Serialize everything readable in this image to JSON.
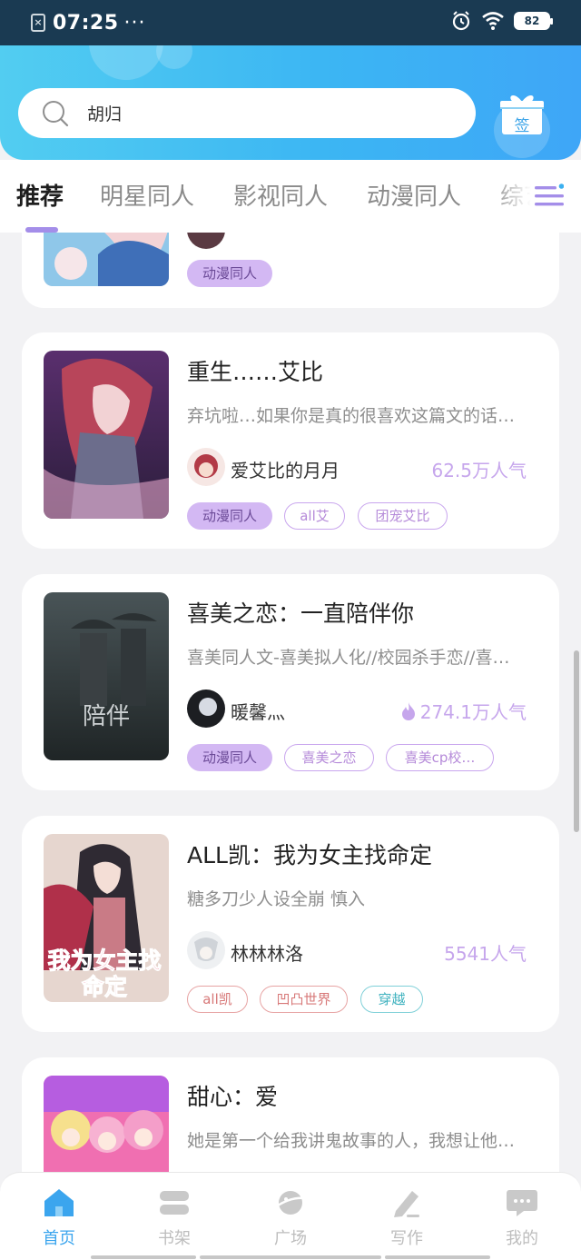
{
  "status_bar": {
    "time": "07:25",
    "dots": "···",
    "battery": "82"
  },
  "search": {
    "query": "胡归"
  },
  "checkin": {
    "label": "签"
  },
  "tabs": [
    {
      "label": "推荐"
    },
    {
      "label": "明星同人"
    },
    {
      "label": "影视同人"
    },
    {
      "label": "动漫同人"
    },
    {
      "label": "综艺"
    }
  ],
  "cards": [
    {
      "title": "",
      "author": "",
      "popularity": "",
      "tags": [
        "动漫同人"
      ]
    },
    {
      "title": "重生……艾比",
      "desc": "弃坑啦…如果你是真的很喜欢这篇文的话…",
      "author": "爱艾比的月月",
      "popularity": "62.5万人气",
      "tags": [
        "动漫同人",
        "all艾",
        "团宠艾比"
      ]
    },
    {
      "title": "喜美之恋：一直陪伴你",
      "desc": "喜美同人文-喜美拟人化//校园杀手恋//喜…",
      "author": "暖馨灬",
      "popularity": "274.1万人气",
      "tags": [
        "动漫同人",
        "喜美之恋",
        "喜美cp校…"
      ]
    },
    {
      "title": "ALL凯：我为女主找命定",
      "desc": "糖多刀少人设全崩 慎入",
      "author": "林林林洛",
      "popularity": "5541人气",
      "tags": [
        "all凯",
        "凹凸世界",
        "穿越"
      ],
      "cover_text": "我为女主找命定"
    },
    {
      "title": "甜心：爱",
      "desc": "她是第一个给我讲鬼故事的人，我想让他…"
    }
  ],
  "bottom_nav": [
    {
      "label": "首页",
      "icon": "home-icon"
    },
    {
      "label": "书架",
      "icon": "bookshelf-icon"
    },
    {
      "label": "广场",
      "icon": "planet-icon"
    },
    {
      "label": "写作",
      "icon": "pen-icon"
    },
    {
      "label": "我的",
      "icon": "chat-bubble-icon"
    }
  ],
  "colors": {
    "accent": "#3ba5ee",
    "tag_purple": "#d3b8f3",
    "popularity": "#c6a6ec"
  }
}
